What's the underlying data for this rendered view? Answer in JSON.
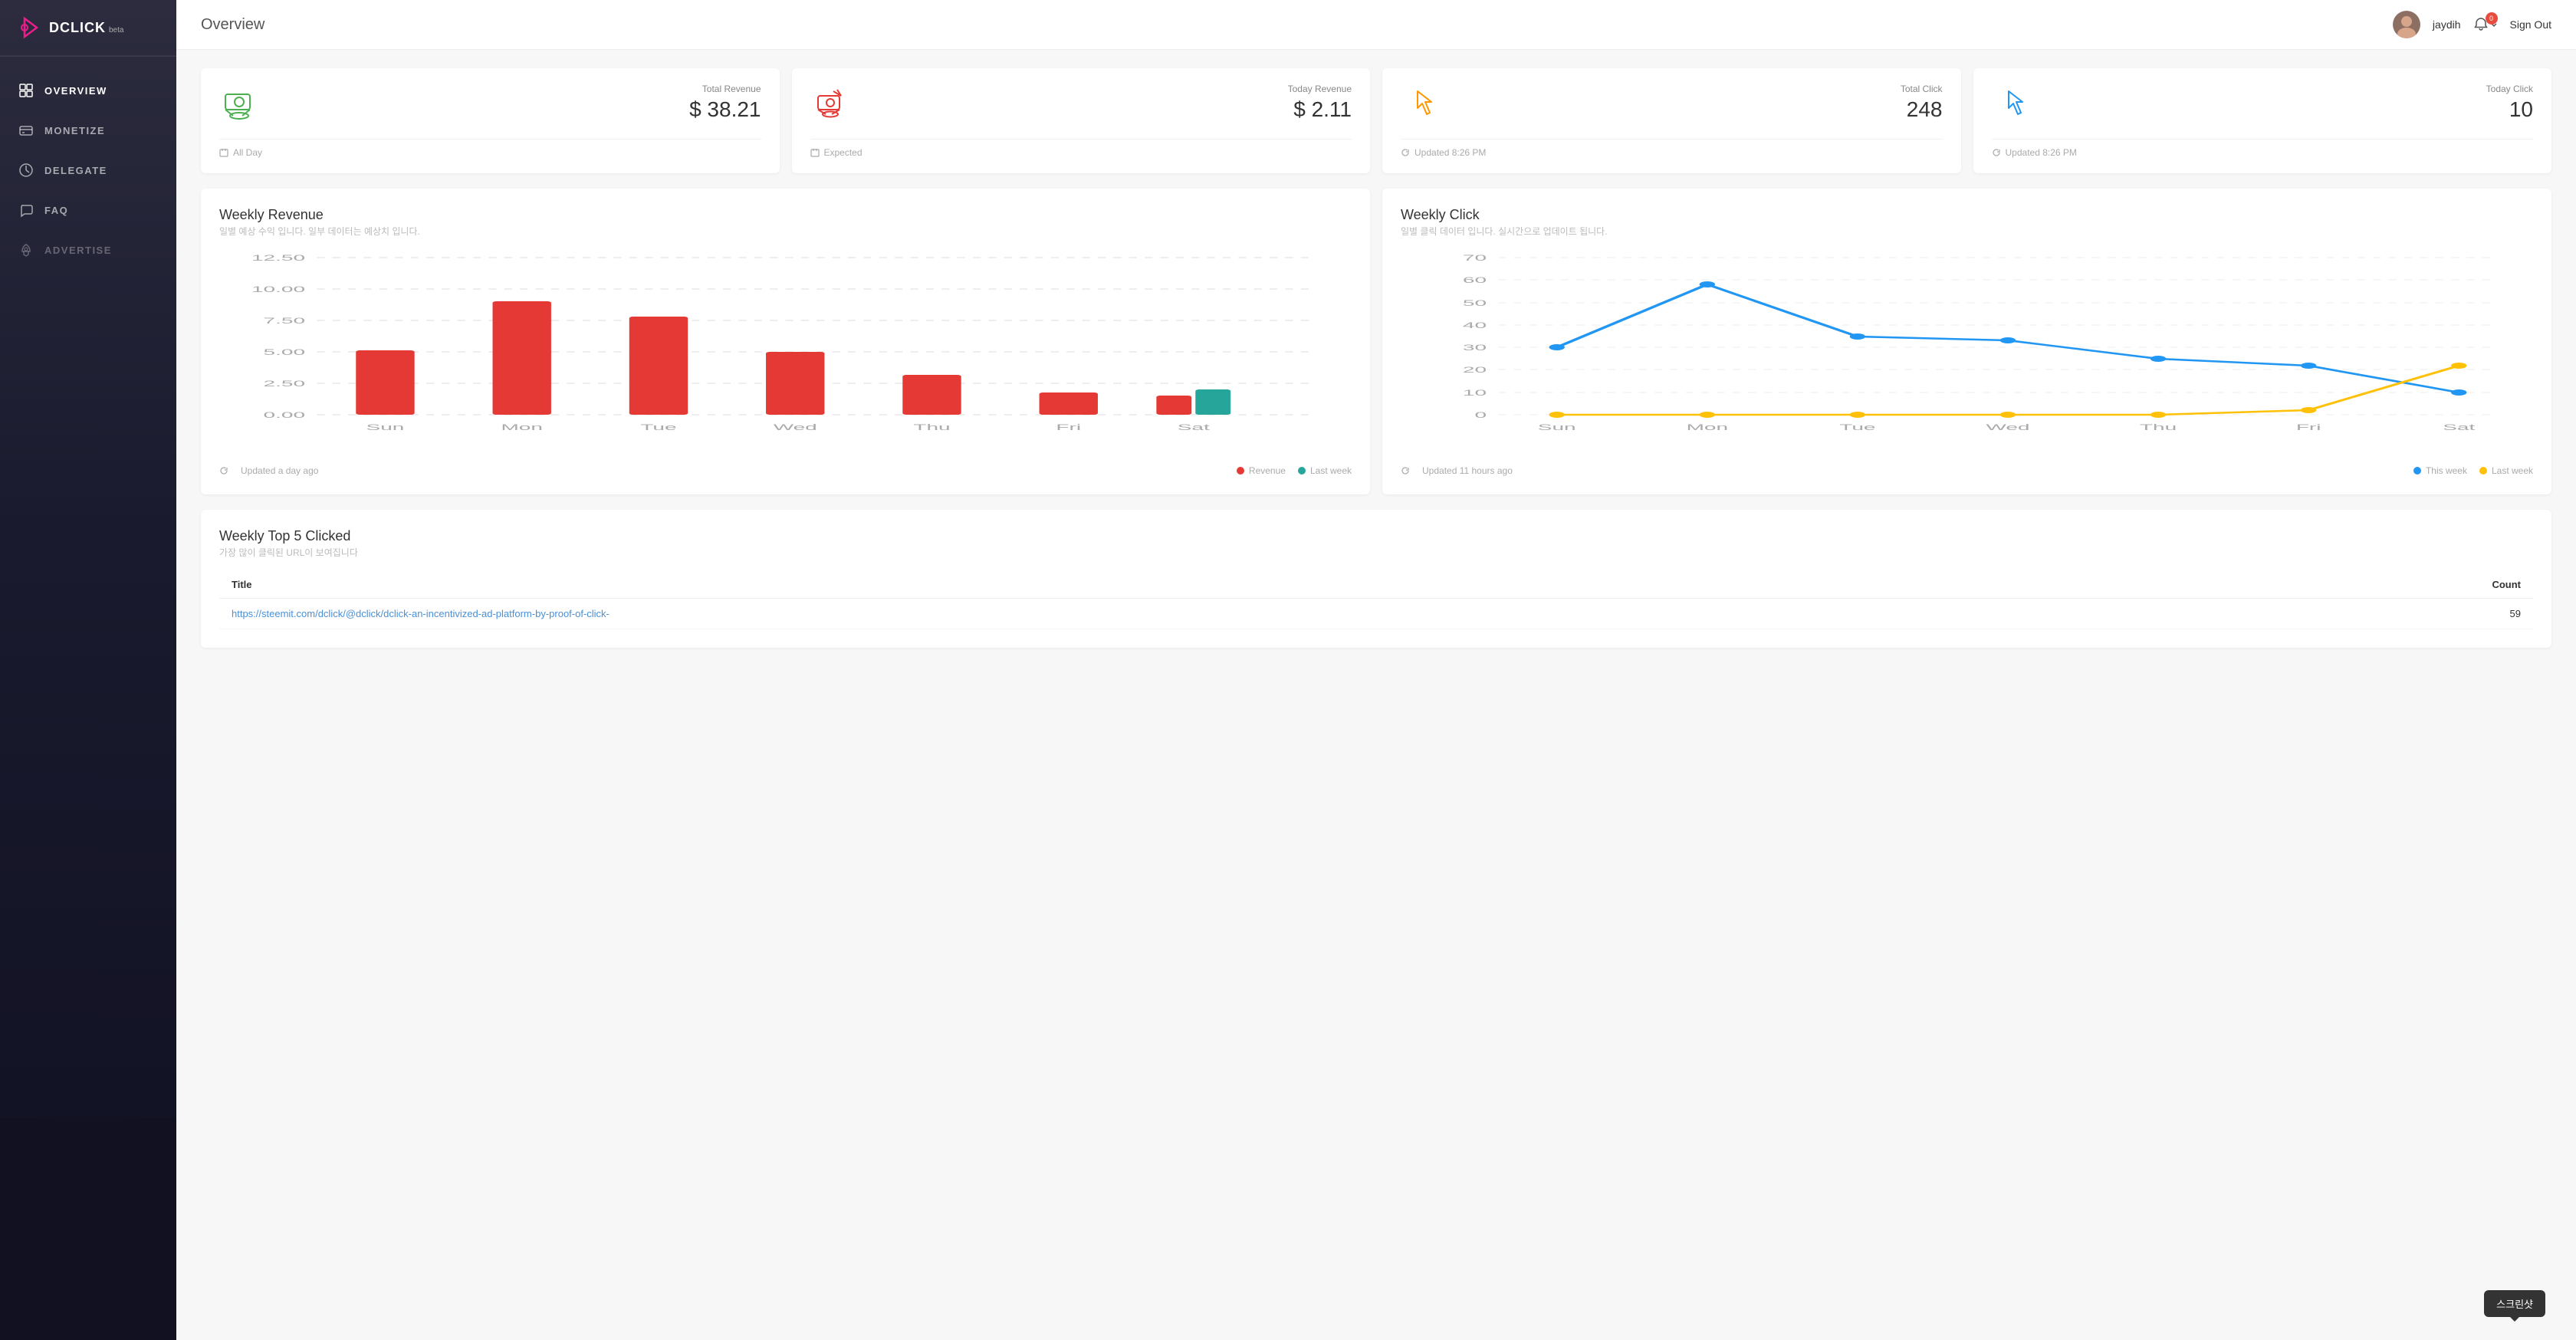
{
  "app": {
    "name": "DCLICK",
    "beta": "beta",
    "logo_color": "#e91e8c"
  },
  "sidebar": {
    "items": [
      {
        "id": "overview",
        "label": "OVERVIEW",
        "active": true,
        "icon": "grid-icon"
      },
      {
        "id": "monetize",
        "label": "MONETIZE",
        "active": false,
        "icon": "card-icon"
      },
      {
        "id": "delegate",
        "label": "DELEGATE",
        "active": false,
        "icon": "chart-icon"
      },
      {
        "id": "faq",
        "label": "FAQ",
        "active": false,
        "icon": "chat-icon"
      },
      {
        "id": "advertise",
        "label": "ADVERTISE",
        "active": false,
        "icon": "rocket-icon"
      }
    ]
  },
  "header": {
    "title": "Overview",
    "username": "jaydih",
    "notification_count": "0",
    "signout_label": "Sign Out"
  },
  "stats": [
    {
      "id": "total-revenue",
      "label": "Total Revenue",
      "value": "$ 38.21",
      "footer": "All Day",
      "icon_color": "#4caf50"
    },
    {
      "id": "today-revenue",
      "label": "Today Revenue",
      "value": "$ 2.11",
      "footer": "Expected",
      "icon_color": "#e53935"
    },
    {
      "id": "total-click",
      "label": "Total Click",
      "value": "248",
      "footer": "Updated 8:26 PM",
      "icon_color": "#ff9800"
    },
    {
      "id": "today-click",
      "label": "Today Click",
      "value": "10",
      "footer": "Updated 8:26 PM",
      "icon_color": "#2196f3"
    }
  ],
  "weekly_revenue": {
    "title": "Weekly Revenue",
    "subtitle": "일별 예상 수익 입니다. 일부 데이터는 예상치 입니다.",
    "footer": "Updated a day ago",
    "legend": [
      {
        "label": "Revenue",
        "color": "#e53935"
      },
      {
        "label": "Last week",
        "color": "#26a69a"
      }
    ],
    "y_labels": [
      "12.50",
      "10.00",
      "7.50",
      "5.00",
      "2.50",
      "0.00"
    ],
    "x_labels": [
      "Sun",
      "Mon",
      "Tue",
      "Wed",
      "Thu",
      "Fri",
      "Sat"
    ],
    "bars": [
      {
        "day": "Sun",
        "revenue": 5.1,
        "last_week": 0
      },
      {
        "day": "Mon",
        "revenue": 9.0,
        "last_week": 0
      },
      {
        "day": "Tue",
        "revenue": 7.8,
        "last_week": 0
      },
      {
        "day": "Wed",
        "revenue": 5.0,
        "last_week": 0
      },
      {
        "day": "Thu",
        "revenue": 3.2,
        "last_week": 0
      },
      {
        "day": "Fri",
        "revenue": 1.8,
        "last_week": 0
      },
      {
        "day": "Sat",
        "revenue": 1.5,
        "last_week": 2.0
      }
    ]
  },
  "weekly_click": {
    "title": "Weekly Click",
    "subtitle": "일별 클릭 데이터 입니다. 실시간으로 업데이트 됩니다.",
    "footer": "Updated 11 hours ago",
    "legend": [
      {
        "label": "This week",
        "color": "#2196f3"
      },
      {
        "label": "Last week",
        "color": "#ffc107"
      }
    ],
    "y_labels": [
      "70",
      "60",
      "50",
      "40",
      "30",
      "20",
      "10",
      "0"
    ],
    "x_labels": [
      "Sun",
      "Mon",
      "Tue",
      "Wed",
      "Thu",
      "Fri",
      "Sat"
    ],
    "this_week": [
      30,
      58,
      35,
      33,
      25,
      22,
      10
    ],
    "last_week": [
      0,
      0,
      0,
      0,
      0,
      2,
      22
    ]
  },
  "weekly_top5": {
    "title": "Weekly Top 5 Clicked",
    "subtitle": "가장 많이 클릭된 URL이 보여집니다",
    "columns": [
      "Title",
      "Count"
    ],
    "rows": [
      {
        "url": "https://steemit.com/dclick/@dclick/dclick-an-incentivized-ad-platform-by-proof-of-click-",
        "count": "59"
      }
    ]
  },
  "tooltip": {
    "label": "스크린샷"
  }
}
